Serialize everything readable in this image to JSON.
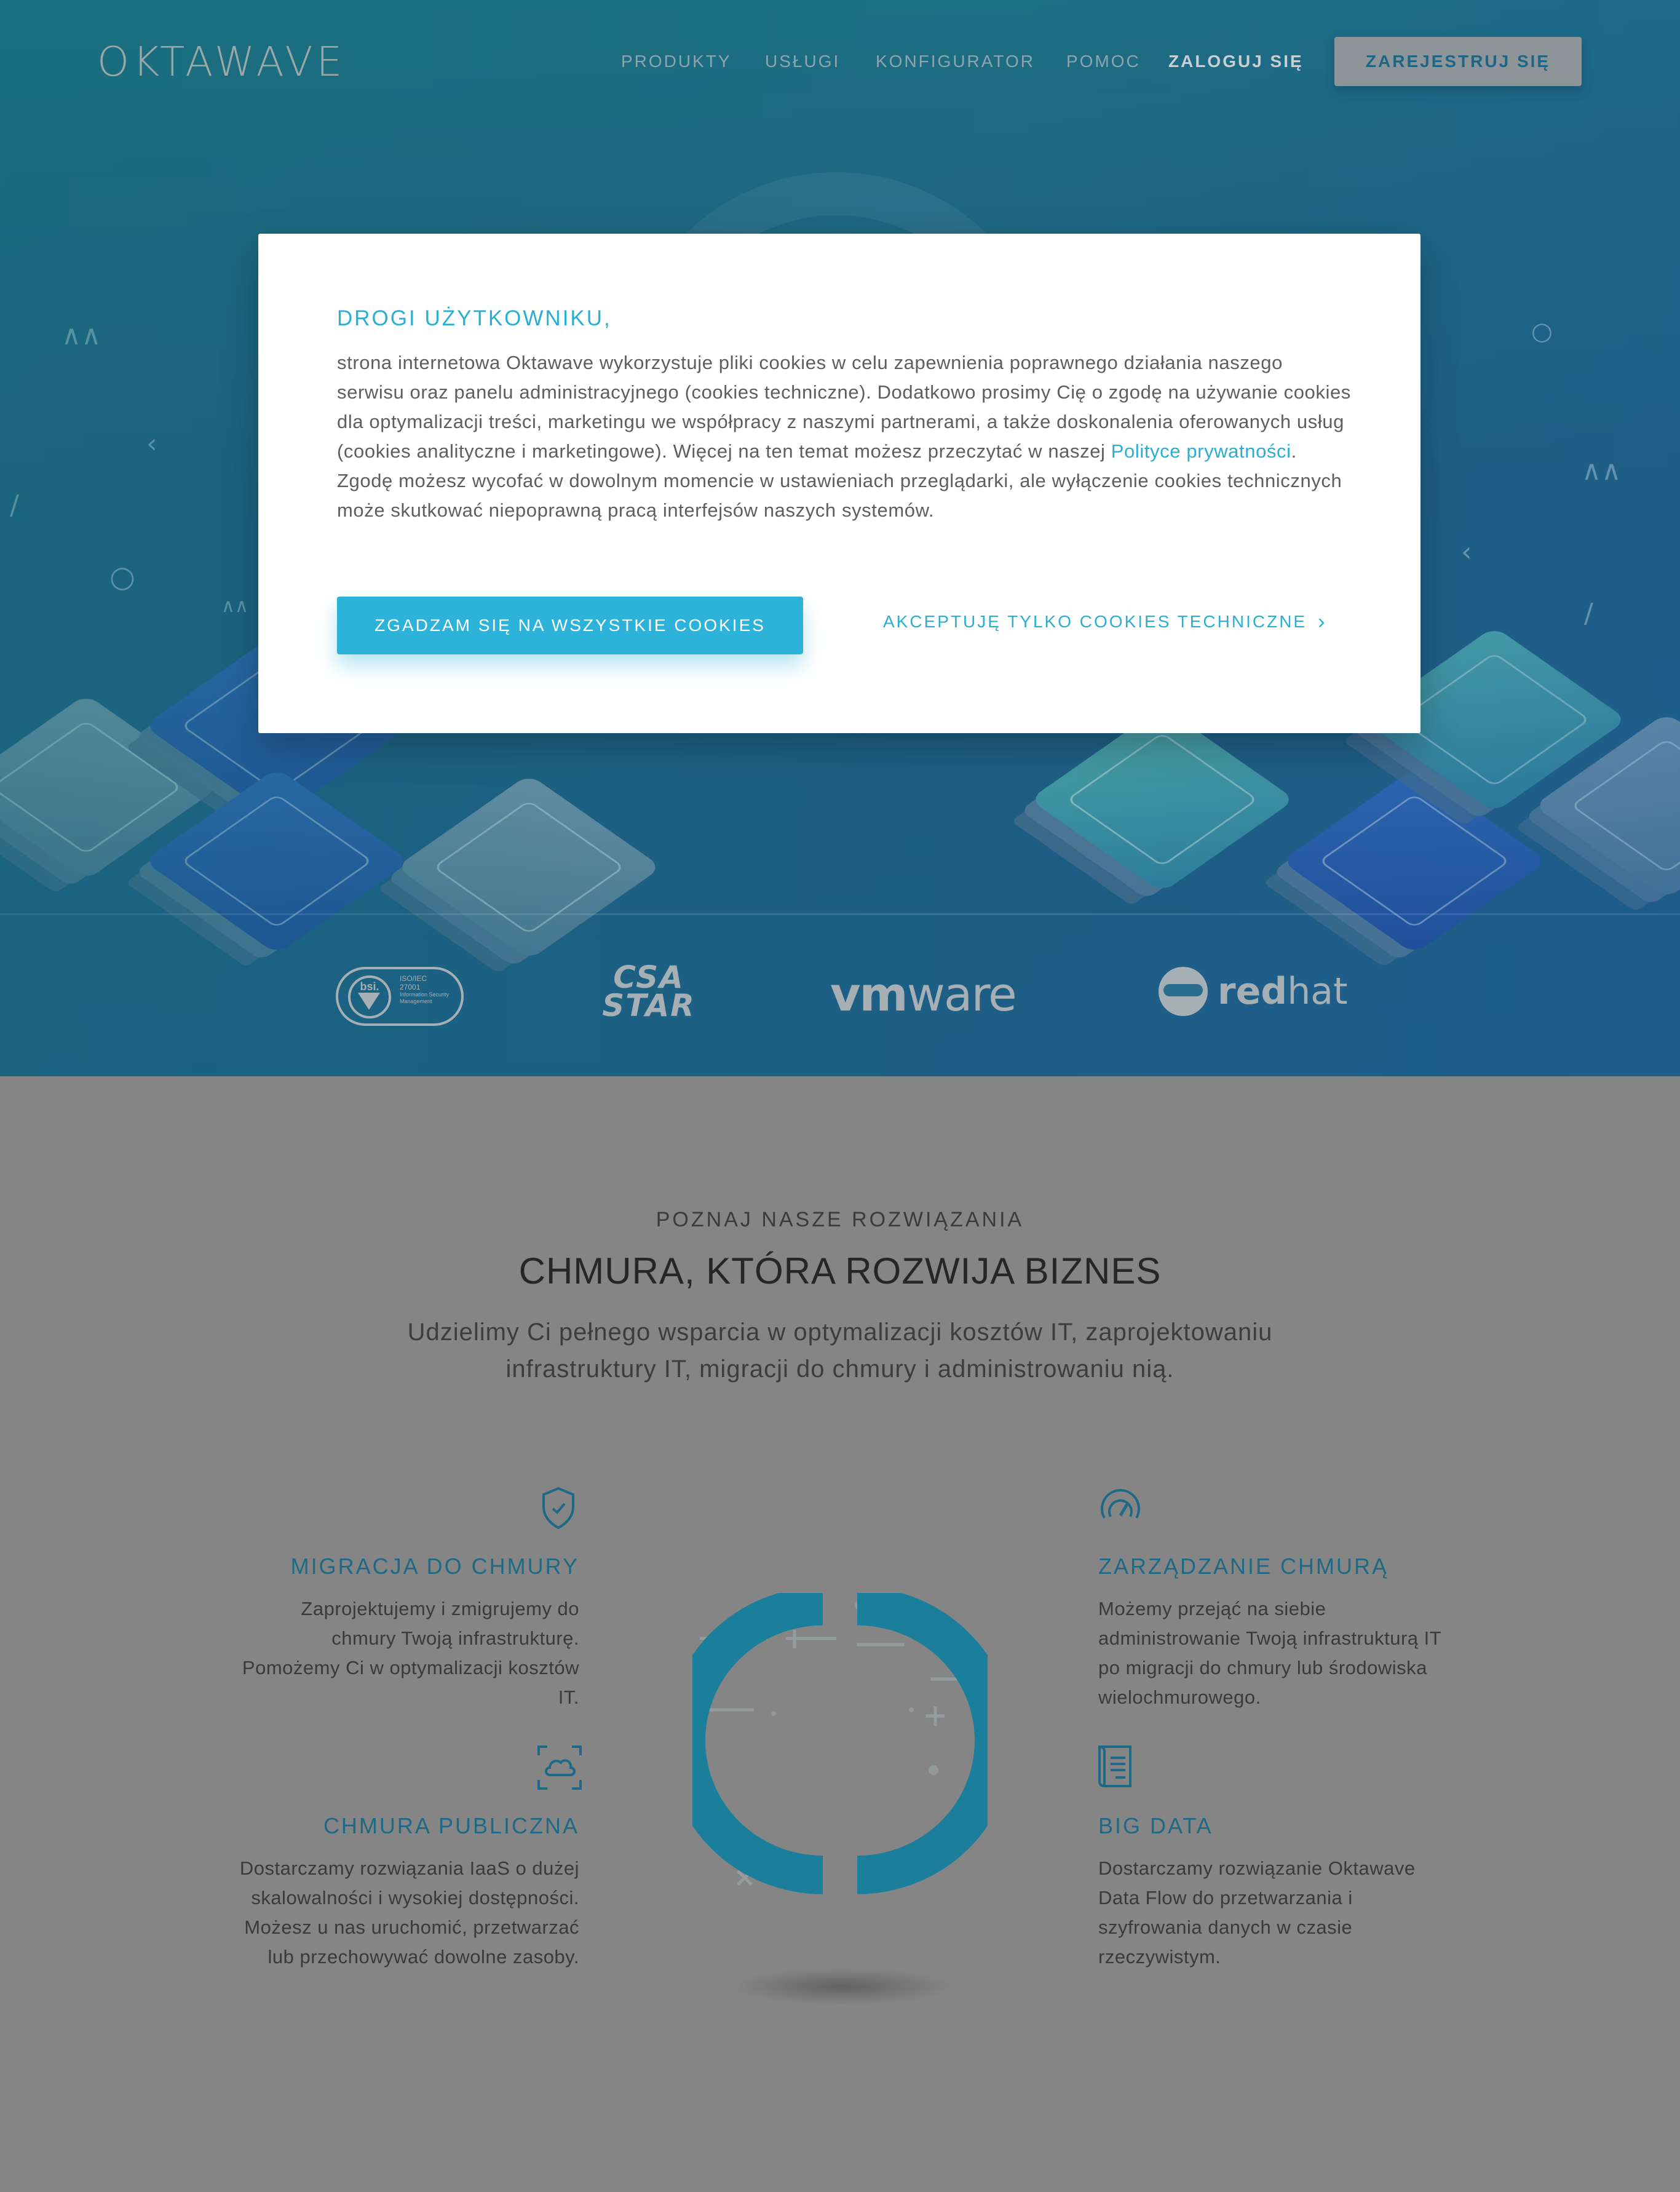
{
  "nav": {
    "logo": "OKTAWAVE",
    "items": [
      {
        "label": "PRODUKTY"
      },
      {
        "label": "USŁUGI"
      },
      {
        "label": "KONFIGURATOR"
      },
      {
        "label": "POMOC"
      }
    ],
    "login": "ZALOGUJ SIĘ",
    "register": "ZAREJESTRUJ SIĘ"
  },
  "cookie_modal": {
    "title": "DROGI UŻYTKOWNIKU,",
    "text_before_link": "strona internetowa Oktawave wykorzystuje pliki cookies w celu zapewnienia poprawnego działania naszego serwisu oraz panelu administracyjnego (cookies techniczne). Dodatkowo prosimy Cię o zgodę na używanie cookies dla optymalizacji treści, marketingu we współpracy z naszymi partnerami, a także doskonalenia oferowanych usług (cookies analityczne i marketingowe). Więcej na ten temat możesz przeczytać w naszej ",
    "link": "Polityce prywatności",
    "text_after_link": ". Zgodę możesz wycofać w dowolnym momencie w ustawieniach przeglądarki, ale wyłączenie cookies technicznych może skutkować niepoprawną pracą interfejsów naszych systemów.",
    "accept_all": "ZGADZAM SIĘ NA WSZYSTKIE COOKIES",
    "accept_technical": "AKCEPTUJĘ TYLKO COOKIES TECHNICZNE",
    "accent_color": "#2db3d9"
  },
  "partners": {
    "iso": {
      "badge": "bsi.",
      "lines": [
        "ISO/IEC",
        "27001",
        "Information Security",
        "Management"
      ]
    },
    "csa": [
      "CSA",
      "STAR"
    ],
    "vmware": {
      "bold": "vm",
      "rest": "ware"
    },
    "redhat": {
      "bold": "red",
      "rest": "hat"
    }
  },
  "solutions": {
    "eyebrow": "POZNAJ NASZE ROZWIĄZANIA",
    "title": "CHMURA, KTÓRA ROZWIJA BIZNES",
    "lead": "Udzielimy Ci pełnego wsparcia w optymalizacji kosztów IT, zaprojektowaniu infrastruktury IT, migracji do chmury i administrowaniu nią.",
    "features": [
      {
        "icon": "shield-icon",
        "title": "MIGRACJA DO CHMURY",
        "text": "Zaprojektujemy i zmigrujemy do chmury Twoją infrastrukturę. Pomożemy Ci w optymalizacji kosztów IT."
      },
      {
        "icon": "cloud-icon",
        "title": "CHMURA PUBLICZNA",
        "text": "Dostarczamy rozwiązania IaaS o dużej skalowalności i wysokiej dostępności. Możesz u nas uruchomić, przetwarzać lub przechowywać dowolne zasoby."
      },
      {
        "icon": "gauge-icon",
        "title": "ZARZĄDZANIE CHMURĄ",
        "text": "Możemy przejąć na siebie administrowanie Twoją infrastrukturą IT po migracji do chmury lub środowiska wielochmurowego."
      },
      {
        "icon": "document-icon",
        "title": "BIG DATA",
        "text": "Dostarczamy rozwiązanie Oktawave Data Flow do przetwarzania i szyfrowania danych w czasie rzeczywistym."
      }
    ]
  }
}
